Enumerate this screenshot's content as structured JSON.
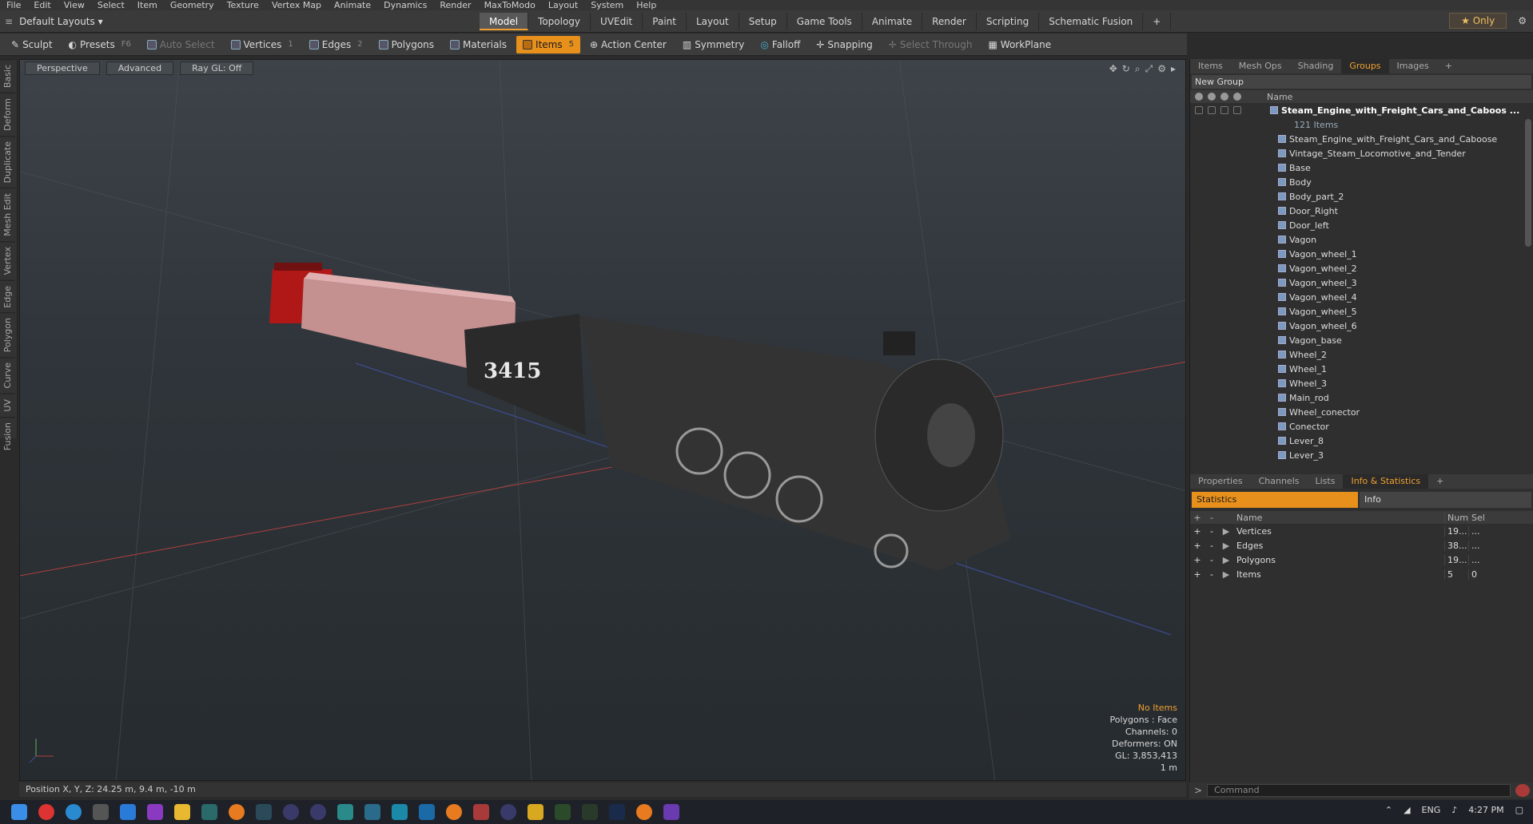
{
  "menu": [
    "File",
    "Edit",
    "View",
    "Select",
    "Item",
    "Geometry",
    "Texture",
    "Vertex Map",
    "Animate",
    "Dynamics",
    "Render",
    "MaxToModo",
    "Layout",
    "System",
    "Help"
  ],
  "layout": {
    "selector": "Default Layouts ▾",
    "tabs": [
      "Model",
      "Topology",
      "UVEdit",
      "Paint",
      "Layout",
      "Setup",
      "Game Tools",
      "Animate",
      "Render",
      "Scripting",
      "Schematic Fusion"
    ],
    "active": "Model",
    "only": "Only",
    "plus": "+"
  },
  "toolbar": {
    "sculpt": "Sculpt",
    "presets": "Presets",
    "presets_key": "F6",
    "auto_select": "Auto Select",
    "vertices": "Vertices",
    "vertices_key": "1",
    "edges": "Edges",
    "edges_key": "2",
    "polygons": "Polygons",
    "materials": "Materials",
    "items": "Items",
    "items_key": "5",
    "action_center": "Action Center",
    "symmetry": "Symmetry",
    "falloff": "Falloff",
    "snapping": "Snapping",
    "select_through": "Select Through",
    "workplane": "WorkPlane"
  },
  "lefttabs": [
    "Basic",
    "Deform",
    "Duplicate",
    "Mesh Edit",
    "Vertex",
    "Edge",
    "Polygon",
    "Curve",
    "UV",
    "Fusion"
  ],
  "viewport": {
    "perspective": "Perspective",
    "advanced": "Advanced",
    "raygl": "Ray GL: Off",
    "number": "3415",
    "stats": {
      "no_items": "No Items",
      "polygons": "Polygons : Face",
      "channels": "Channels: 0",
      "deformers": "Deformers: ON",
      "gl": "GL: 3,853,413",
      "scale": "1 m"
    }
  },
  "status": {
    "position": "Position X, Y, Z:  24.25 m, 9.4 m, -10 m"
  },
  "groups": {
    "tabs": [
      "Items",
      "Mesh Ops",
      "Shading",
      "Groups",
      "Images",
      "+"
    ],
    "active": "Groups",
    "new_group": "New Group",
    "header_name": "Name",
    "root": "Steam_Engine_with_Freight_Cars_and_Caboos ...",
    "root_count": "121 Items",
    "items": [
      "Steam_Engine_with_Freight_Cars_and_Caboose",
      "Vintage_Steam_Locomotive_and_Tender",
      "Base",
      "Body",
      "Body_part_2",
      "Door_Right",
      "Door_left",
      "Vagon",
      "Vagon_wheel_1",
      "Vagon_wheel_2",
      "Vagon_wheel_3",
      "Vagon_wheel_4",
      "Vagon_wheel_5",
      "Vagon_wheel_6",
      "Vagon_base",
      "Wheel_2",
      "Wheel_1",
      "Wheel_3",
      "Main_rod",
      "Wheel_conector",
      "Conector",
      "Lever_8",
      "Lever_3"
    ]
  },
  "info": {
    "tabs": [
      "Properties",
      "Channels",
      "Lists",
      "Info & Statistics",
      "+"
    ],
    "active": "Info & Statistics",
    "statistics": "Statistics",
    "info": "Info",
    "cols": {
      "name": "Name",
      "num": "Num",
      "sel": "Sel"
    },
    "rows": [
      {
        "name": "Vertices",
        "num": "19...",
        "sel": "..."
      },
      {
        "name": "Edges",
        "num": "38...",
        "sel": "..."
      },
      {
        "name": "Polygons",
        "num": "19...",
        "sel": "..."
      },
      {
        "name": "Items",
        "num": "5",
        "sel": "0"
      }
    ]
  },
  "command": {
    "placeholder": "Command"
  },
  "taskbar": {
    "lang": "ENG",
    "time": "4:27 PM"
  }
}
